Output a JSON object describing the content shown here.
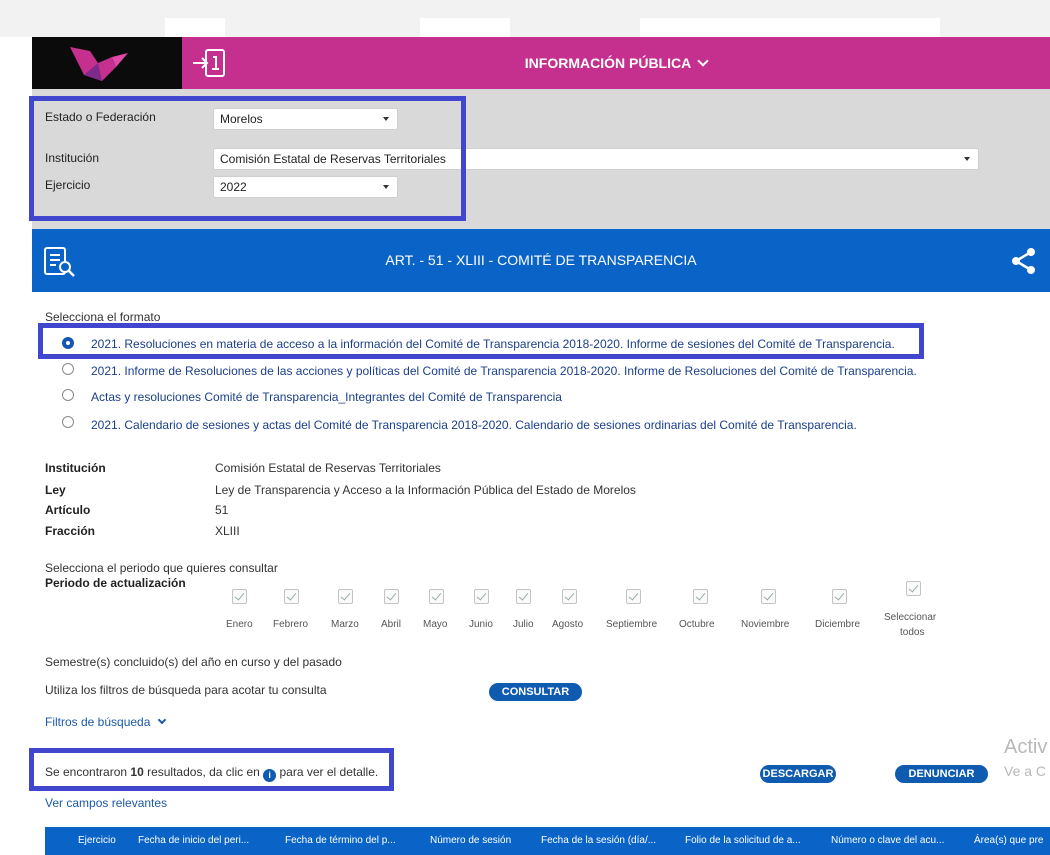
{
  "header": {
    "title": "INFORMACIÓN PÚBLICA"
  },
  "filters": {
    "estado": {
      "label": "Estado o Federación",
      "value": "Morelos"
    },
    "institucion": {
      "label": "Institución",
      "value": "Comisión Estatal de Reservas Territoriales"
    },
    "ejercicio": {
      "label": "Ejercicio",
      "value": "2022"
    }
  },
  "section": {
    "title": "ART. - 51 - XLIII - COMITÉ DE TRANSPARENCIA"
  },
  "formats": {
    "label": "Selecciona el formato",
    "options": [
      {
        "label": "2021. Resoluciones en materia de acceso a la información del Comité de Transparencia 2018-2020. Informe de sesiones del Comité de Transparencia.",
        "selected": true
      },
      {
        "label": "2021. Informe de Resoluciones de las acciones y políticas del Comité de Transparencia 2018-2020. Informe de Resoluciones del Comité de Transparencia.",
        "selected": false
      },
      {
        "label": "Actas y resoluciones Comité de Transparencia_Integrantes del Comité de Transparencia",
        "selected": false
      },
      {
        "label": "2021. Calendario de sesiones y actas del Comité de Transparencia 2018-2020. Calendario de sesiones ordinarias del Comité de Transparencia.",
        "selected": false
      }
    ]
  },
  "details": [
    {
      "key": "Institución",
      "value": "Comisión Estatal de Reservas Territoriales"
    },
    {
      "key": "Ley",
      "value": "Ley de Transparencia y Acceso a la Información Pública del Estado de Morelos"
    },
    {
      "key": "Artículo",
      "value": "51"
    },
    {
      "key": "Fracción",
      "value": "XLIII"
    }
  ],
  "periodo": {
    "prompt": "Selecciona el periodo que quieres consultar",
    "label": "Periodo de actualización",
    "months": [
      "Enero",
      "Febrero",
      "Marzo",
      "Abril",
      "Mayo",
      "Junio",
      "Julio",
      "Agosto",
      "Septiembre",
      "Octubre",
      "Noviembre",
      "Diciembre"
    ],
    "select_all_line1": "Seleccionar",
    "select_all_line2": "todos"
  },
  "semestre_text": "Semestre(s) concluido(s) del año en curso y del pasado",
  "filters_hint": "Utiliza los filtros de búsqueda para acotar tu consulta",
  "consultar_label": "CONSULTAR",
  "filtros_busqueda_label": "Filtros de búsqueda",
  "results": {
    "prefix": "Se encontraron ",
    "count": "10",
    "middle": " resultados, da clic en ",
    "suffix": " para ver el detalle."
  },
  "descargar_label": "DESCARGAR",
  "denunciar_label": "DENUNCIAR",
  "ver_campos_label": "Ver campos relevantes",
  "watermark": {
    "line1": "Activ",
    "line2": "Ve a C"
  },
  "table_headers": [
    "Ejercicio",
    "Fecha de inicio del peri...",
    "Fecha de término del p...",
    "Número de sesión",
    "Fecha de la sesión (día/...",
    "Folio de la solicitud de a...",
    "Número o clave del acu...",
    "Área(s) que pre"
  ],
  "colors": {
    "pink": "#c5308f",
    "blue": "#0a64c7",
    "highlight": "#4146cf"
  }
}
